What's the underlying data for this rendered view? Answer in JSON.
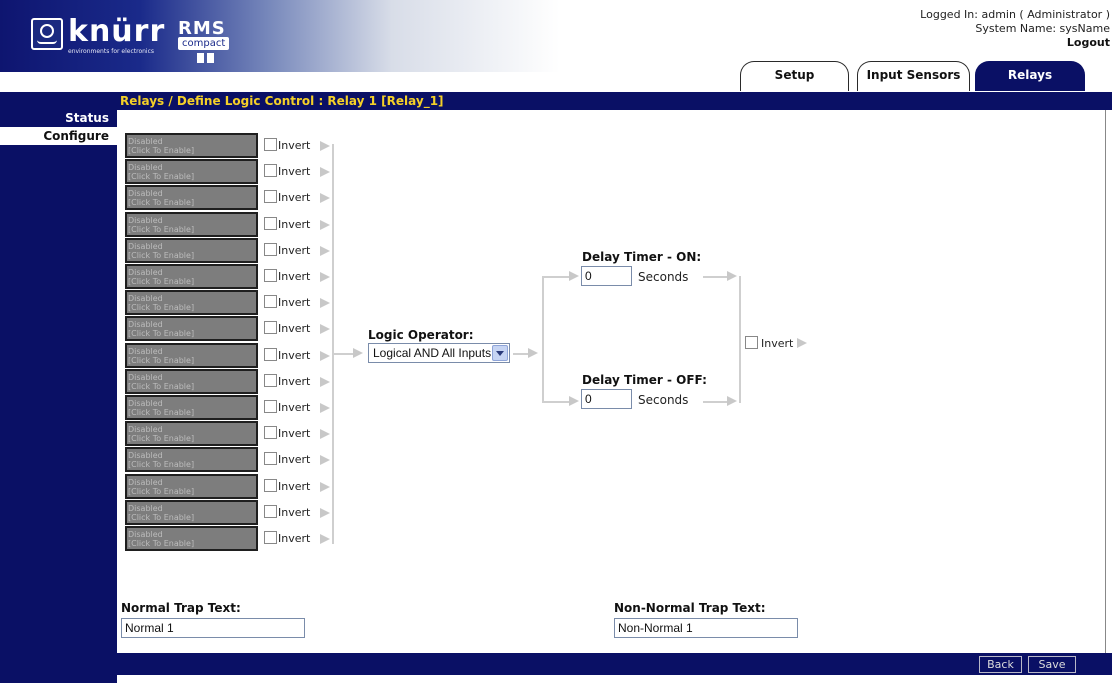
{
  "header": {
    "brand_logo_text": "knürr",
    "brand_tagline": "environments for electronics",
    "product_name": "RMS",
    "product_badge": "compact",
    "logged_in_text": "Logged In: admin ( Administrator )",
    "system_name_text": "System Name: sysName",
    "logout_label": "Logout"
  },
  "tabs": [
    {
      "label": "Setup",
      "active": false
    },
    {
      "label": "Input Sensors",
      "active": false
    },
    {
      "label": "Relays",
      "active": true
    }
  ],
  "sidebar": {
    "items": [
      {
        "label": "Status",
        "active": false
      },
      {
        "label": "Configure",
        "active": true
      }
    ]
  },
  "breadcrumb": "Relays / Define Logic Control : Relay 1 [Relay_1]",
  "inputs": {
    "disabled_line1": "Disabled",
    "disabled_line2": "[Click To Enable]",
    "invert_label": "Invert",
    "count": 16
  },
  "logic": {
    "label": "Logic Operator:",
    "selected": "Logical AND All Inputs"
  },
  "delay_on": {
    "label": "Delay Timer - ON:",
    "value": "0",
    "unit": "Seconds"
  },
  "delay_off": {
    "label": "Delay Timer - OFF:",
    "value": "0",
    "unit": "Seconds"
  },
  "output": {
    "invert_label": "Invert"
  },
  "trap": {
    "normal_label": "Normal Trap Text:",
    "normal_value": "Normal 1",
    "non_normal_label": "Non-Normal Trap Text:",
    "non_normal_value": "Non-Normal 1"
  },
  "buttons": {
    "back": "Back",
    "save": "Save"
  },
  "colors": {
    "navy": "#0a1065",
    "crumb_text": "#f4d028",
    "disabled_fill": "#7d7d7d"
  }
}
